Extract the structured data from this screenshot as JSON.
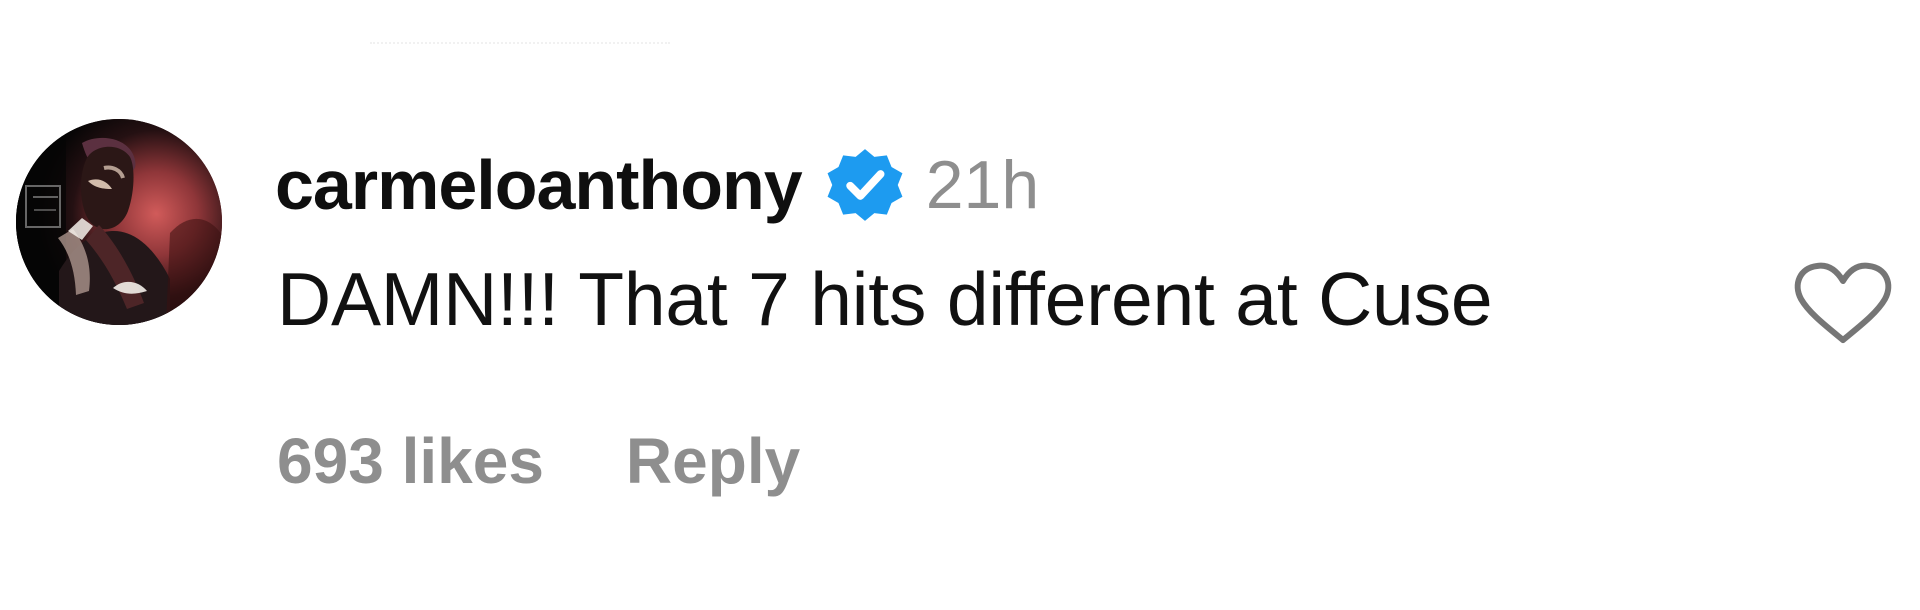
{
  "comment": {
    "username": "carmeloanthony",
    "verified": true,
    "timestamp": "21h",
    "text": "DAMN!!! That 7 hits different at Cuse",
    "likes": "693 likes",
    "reply_label": "Reply",
    "liked": false
  },
  "icons": {
    "avatar": "profile-photo",
    "verified": "verified-badge-icon",
    "like": "heart-outline-icon"
  },
  "colors": {
    "username": "#0f0f0f",
    "comment_text": "#111111",
    "secondary_text": "#8e8e8e",
    "verified_badge": "#1d9bf0",
    "background": "#ffffff"
  }
}
